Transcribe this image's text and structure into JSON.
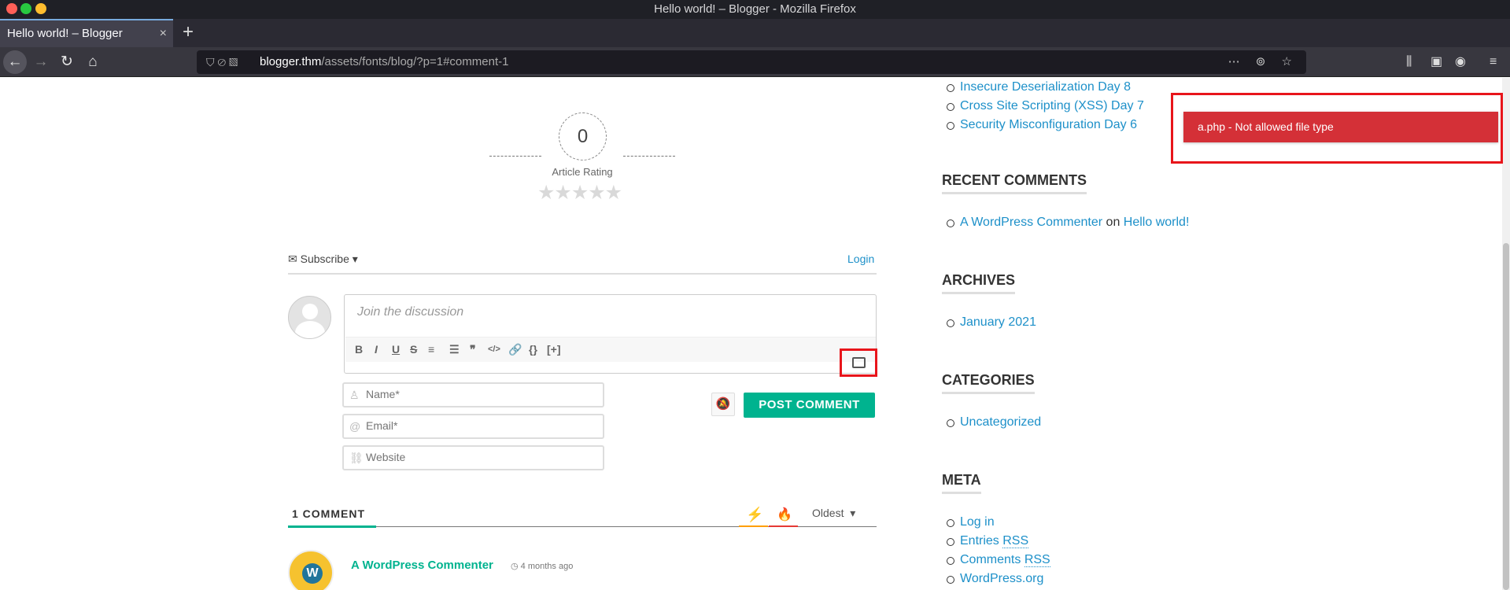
{
  "browser": {
    "window_title": "Hello world! – Blogger - Mozilla Firefox",
    "tab_title": "Hello world! – Blogger",
    "tab_close_icon": "×",
    "url_domain": "blogger.thm",
    "url_path": "/assets/fonts/blog/?p=1#comment-1"
  },
  "rating": {
    "value": "0",
    "label": "Article Rating",
    "stars": "★★★★★"
  },
  "comments": {
    "subscribe_label": "Subscribe",
    "login_label": "Login",
    "editor_placeholder": "Join the discussion",
    "toolbar": {
      "bold": "B",
      "italic": "I",
      "underline": "U",
      "strike": "S",
      "ordered_list": "≡",
      "unordered_list": "☰",
      "quote": "❞",
      "code": "</>",
      "link": "🔗",
      "code_block": "{}",
      "spoiler": "[+]"
    },
    "name_placeholder": "Name*",
    "email_placeholder": "Email*",
    "website_placeholder": "Website",
    "post_button": "POST COMMENT",
    "count_label": "1 COMMENT",
    "sort_label": "Oldest",
    "commenter_name": "A WordPress Commenter",
    "comment_time": "4 months ago"
  },
  "sidebar": {
    "recent_posts": [
      "Insecure Deserialization Day 8",
      "Cross Site Scripting (XSS) Day 7",
      "Security Misconfiguration Day 6"
    ],
    "recent_comments": {
      "heading": "RECENT COMMENTS",
      "author": "A WordPress Commenter",
      "connector": "on",
      "post": "Hello world!"
    },
    "archives": {
      "heading": "ARCHIVES",
      "item": "January 2021"
    },
    "categories": {
      "heading": "CATEGORIES",
      "item": "Uncategorized"
    },
    "meta": {
      "heading": "META",
      "login": "Log in",
      "entries_prefix": "Entries",
      "comments_prefix": "Comments",
      "rss": "RSS",
      "wordpress": "WordPress.org"
    }
  },
  "notification": {
    "message": "a.php - Not allowed file type"
  },
  "colors": {
    "accent": "#00b38f",
    "link": "#1d90c9",
    "error": "#d43037",
    "annotation": "#e8151b"
  }
}
